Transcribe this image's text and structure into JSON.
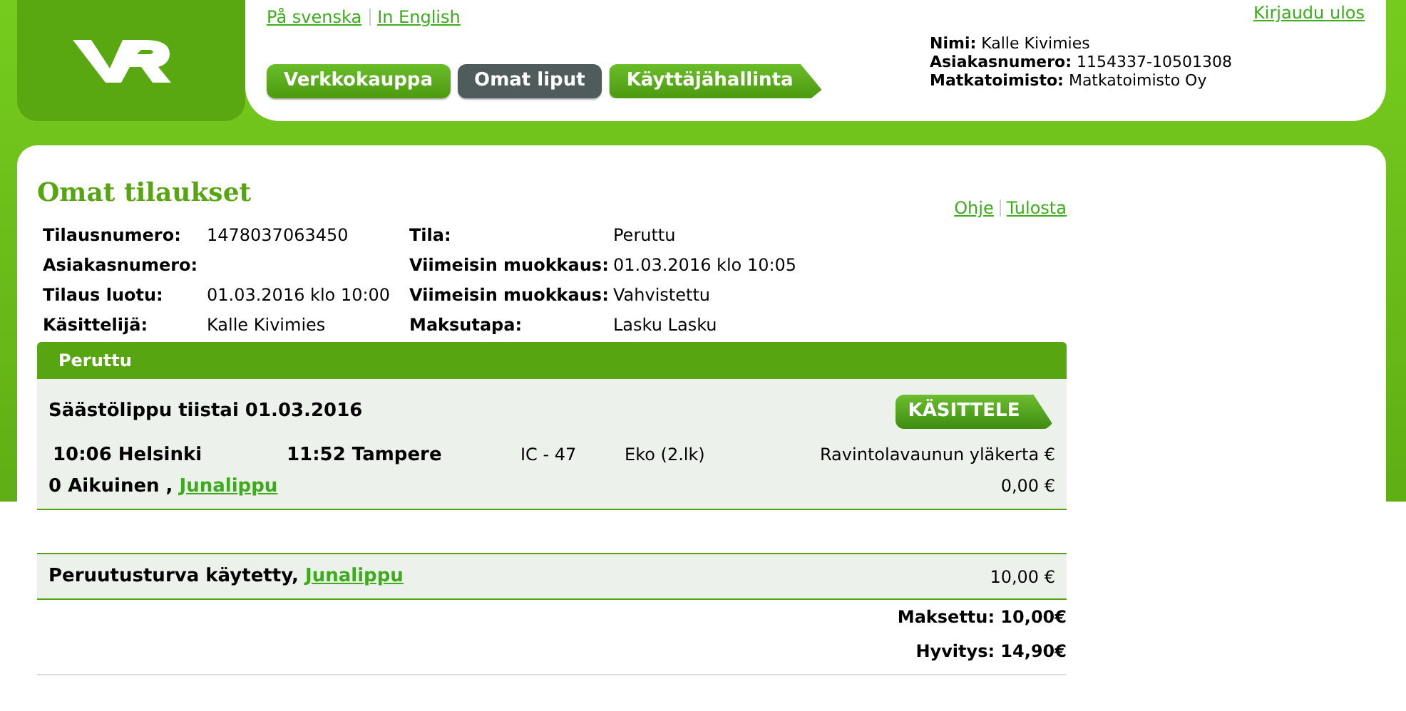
{
  "language_links": [
    {
      "label": "På svenska"
    },
    {
      "label": "In English"
    }
  ],
  "logout": "Kirjaudu ulos",
  "nav_tabs": [
    {
      "label": "Verkkokauppa",
      "selected": false,
      "kind": "plain"
    },
    {
      "label": "Omat liput",
      "selected": true,
      "kind": "plain"
    },
    {
      "label": "Käyttäjähallinta",
      "selected": false,
      "kind": "arrow"
    }
  ],
  "user_info": [
    {
      "label": "Nimi:",
      "value": "Kalle Kivimies"
    },
    {
      "label": "Asiakasnumero:",
      "value": "1154337-10501308"
    },
    {
      "label": "Matkatoimisto:",
      "value": "Matkatoimisto Oy"
    }
  ],
  "page_title": "Omat tilaukset",
  "help_links": [
    {
      "label": "Ohje"
    },
    {
      "label": "Tulosta"
    }
  ],
  "order_details": [
    {
      "label": "Tilausnumero:",
      "value": "1478037063450",
      "label2": "Tila:",
      "value2": "Peruttu"
    },
    {
      "label": "Asiakasnumero:",
      "label2": "Viimeisin muokkaus:",
      "value2": "01.03.2016 klo 10:05"
    },
    {
      "label": "Tilaus luotu:",
      "value": "01.03.2016 klo 10:00",
      "label2": "Viimeisin muokkaus:",
      "value2": "Vahvistettu"
    },
    {
      "label": "Käsittelijä:",
      "value": "Kalle Kivimies",
      "label2": "Maksutapa:",
      "value2": "Lasku Lasku"
    }
  ],
  "section": {
    "title": "Peruttu",
    "ticket": {
      "title": "Säästölippu tiistai 01.03.2016",
      "button": "KÄSITTELE",
      "departure": "10:06 Helsinki",
      "arrival": "11:52 Tampere",
      "train": "IC - 47",
      "class": "Eko (2.lk)",
      "seat": "Ravintolavaunun yläkerta €",
      "passengers": "0 Aikuinen ,",
      "passenger_link": "Junalippu",
      "price": "0,00 €"
    }
  },
  "extra": {
    "text": "Peruutusturva käytetty,",
    "link": "Junalippu",
    "price": "10,00 €"
  },
  "totals": [
    {
      "label": "Maksettu:",
      "value": "10,00€"
    },
    {
      "label": "Hyvitys:",
      "value": "14,90€"
    }
  ]
}
